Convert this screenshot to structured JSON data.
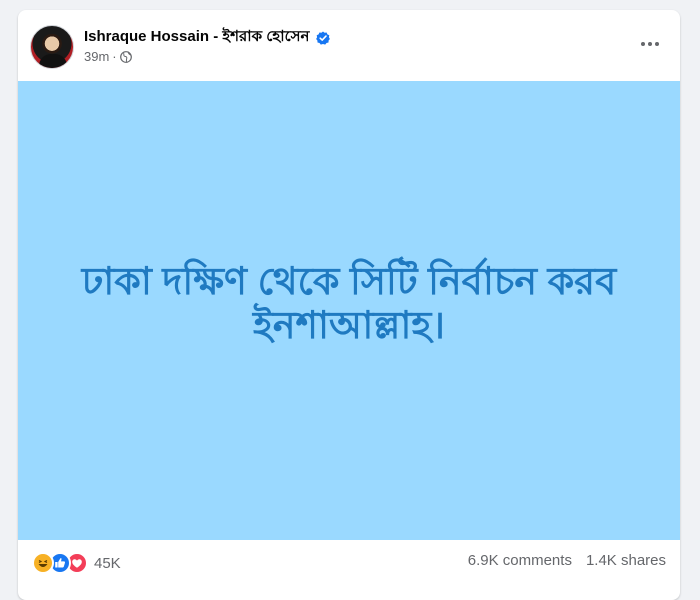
{
  "post": {
    "author": "Ishraque Hossain - ইশরাক হোসেন",
    "time": "39m",
    "separator": "·",
    "body": "ঢাকা দক্ষিণ থেকে সিটি নির্বাচন করব ইনশাআল্লাহ।",
    "background_color": "#9ad9ff",
    "text_color": "#1f7ac1"
  },
  "icons": {
    "verified": "verified-badge-icon",
    "audience": "globe-icon",
    "more": "more-options-icon",
    "reactions": [
      "haha-reaction-icon",
      "like-reaction-icon",
      "love-reaction-icon"
    ]
  },
  "engagement": {
    "reaction_count": "45K",
    "comments": "6.9K comments",
    "shares": "1.4K shares"
  }
}
